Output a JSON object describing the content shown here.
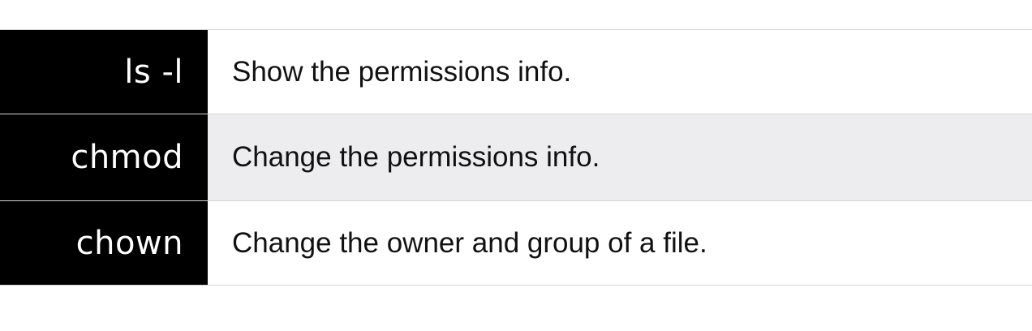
{
  "table": {
    "rows": [
      {
        "command": "ls -l",
        "description": "Show the permissions info."
      },
      {
        "command": "chmod",
        "description": "Change the permissions info."
      },
      {
        "command": "chown",
        "description": "Change the owner and group of a file."
      }
    ]
  },
  "colors": {
    "command_bg": "#000000",
    "command_text": "#ffffff",
    "row_alt_bg": "#ededef",
    "border": "#d4d4d4"
  }
}
